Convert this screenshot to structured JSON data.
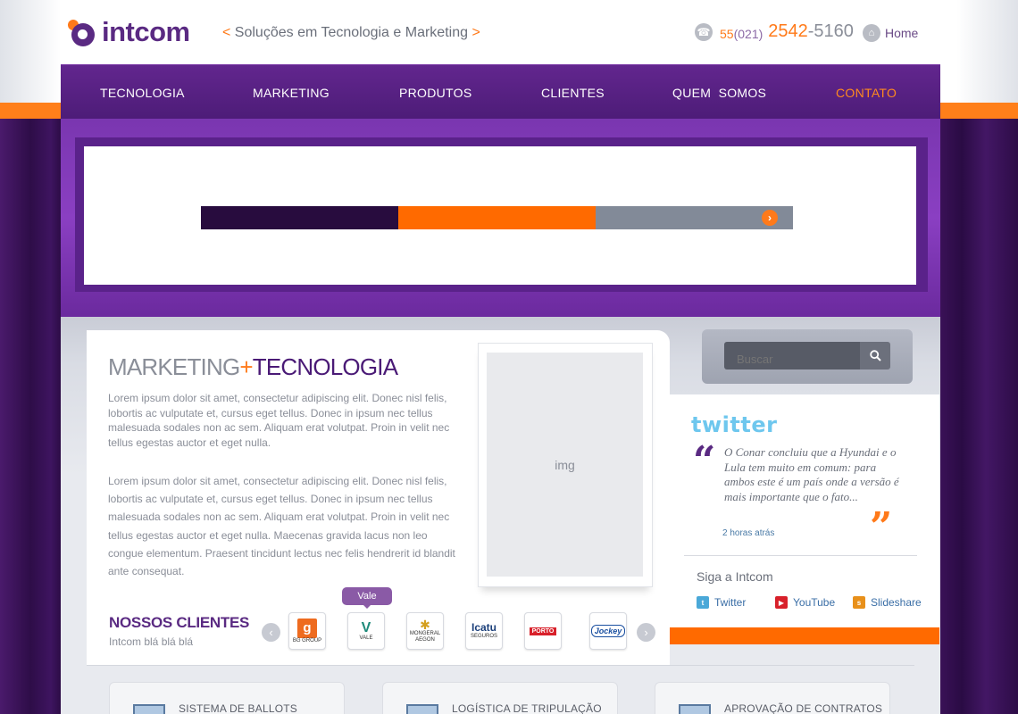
{
  "header": {
    "logo_text": "intcom",
    "tagline_open": "<",
    "tagline": "Soluções em Tecnologia e Marketing",
    "tagline_close": ">",
    "phone_country": "55",
    "phone_area": "(021)",
    "phone_main": "2542",
    "phone_rest": "-5160",
    "home_label": "Home"
  },
  "nav": {
    "items": [
      {
        "label": "TECNOLOGIA"
      },
      {
        "label": "MARKETING"
      },
      {
        "label": "PRODUTOS"
      },
      {
        "label": "CLIENTES"
      },
      {
        "label": "QUEM  SOMOS"
      },
      {
        "label": "CONTATO"
      }
    ]
  },
  "main": {
    "heading_part1": "MARKETING",
    "heading_plus": "+",
    "heading_part2": "TECNOLOGIA",
    "paragraph1": "Lorem ipsum dolor sit amet, consectetur adipiscing elit. Donec nisl felis, lobortis ac vulputate et, cursus eget tellus. Donec in ipsum nec tellus malesuada sodales non ac sem. Aliquam erat volutpat. Proin in velit nec tellus egestas auctor et eget nulla.",
    "paragraph2": "Lorem ipsum dolor sit amet, consectetur adipiscing elit. Donec nisl felis, lobortis ac vulputate et, cursus eget tellus. Donec in ipsum nec tellus malesuada sodales non ac sem. Aliquam erat volutpat. Proin in velit nec tellus egestas auctor et eget nulla. Maecenas gravida lacus non leo congue elementum. Praesent tincidunt lectus nec felis hendrerit id blandit ante consequat.",
    "image_placeholder": "img"
  },
  "clients": {
    "title": "NOSSOS CLIENTES",
    "subtitle": "Intcom blá blá blá",
    "tooltip": "Vale",
    "logos": [
      {
        "mark": "g",
        "label": "BG GROUP",
        "color": "#ee6b1f"
      },
      {
        "mark": "V",
        "label": "VALE",
        "color": "#1e8a7a"
      },
      {
        "mark": "✱",
        "label": "MONGERAL AEGON",
        "color": "#d4a020"
      },
      {
        "mark": "Icatu",
        "label": "SEGUROS",
        "color": "#1b3f7a"
      },
      {
        "mark": "PORTO",
        "label": "",
        "color": "#d8202a"
      },
      {
        "mark": "Jockey",
        "label": "",
        "color": "#1a4fa0"
      }
    ]
  },
  "search": {
    "placeholder": "Buscar",
    "button_icon": "search-icon"
  },
  "twitter": {
    "logo_text": "twitter",
    "tweet": "O Conar concluiu que a Hyundai e o Lula tem muito em comum: para ambos este é um país onde a versão é mais importante que o fato...",
    "time": "2 horas atrás"
  },
  "follow": {
    "title": "Siga a Intcom",
    "links": [
      {
        "label": "Twitter",
        "color": "#4aa8d8"
      },
      {
        "label": "YouTube",
        "color": "#d8202a"
      },
      {
        "label": "Slideshare",
        "color": "#e8901a"
      }
    ]
  },
  "cards": [
    {
      "title": "SISTEMA DE BALLOTS"
    },
    {
      "title": "LOGÍSTICA DE TRIPULAÇÃO"
    },
    {
      "title": "APROVAÇÃO DE CONTRATOS"
    }
  ],
  "colors": {
    "brand_purple": "#5a2a82",
    "brand_orange": "#ff7a1a",
    "banner_dark": "#280c3e",
    "banner_orange": "#ff6a00",
    "banner_gray": "#828a98"
  }
}
